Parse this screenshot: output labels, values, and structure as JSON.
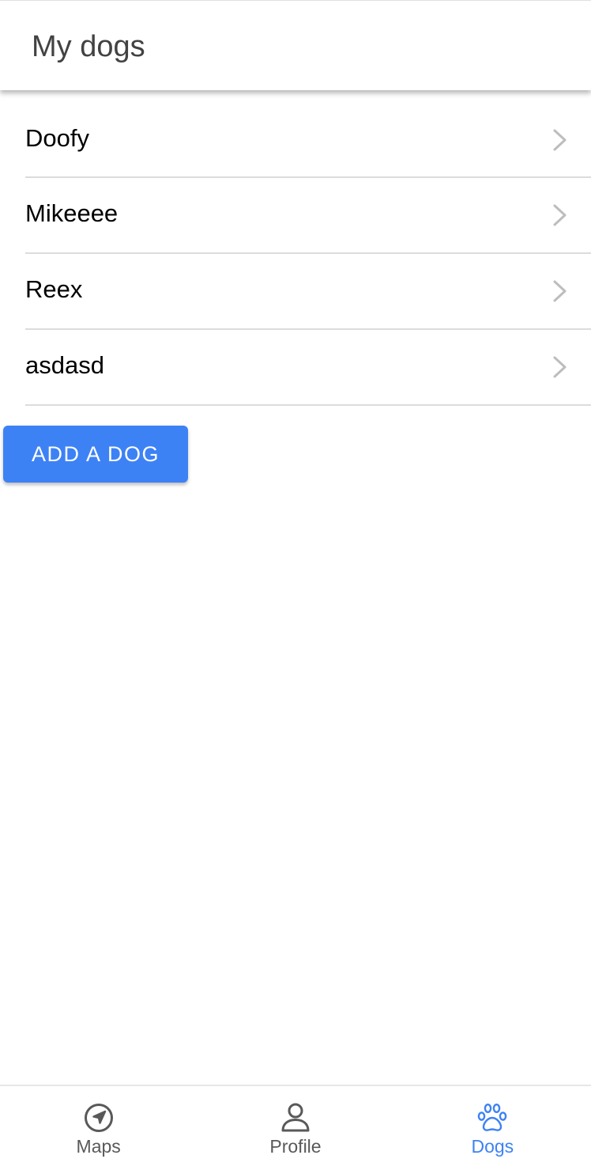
{
  "header": {
    "title": "My dogs"
  },
  "dogs": [
    {
      "name": "Doofy"
    },
    {
      "name": "Mikeeee"
    },
    {
      "name": "Reex"
    },
    {
      "name": "asdasd"
    }
  ],
  "actions": {
    "add_dog_label": "ADD A DOG"
  },
  "tabbar": {
    "tabs": [
      {
        "label": "Maps",
        "icon": "navigation-icon",
        "active": false
      },
      {
        "label": "Profile",
        "icon": "person-icon",
        "active": false
      },
      {
        "label": "Dogs",
        "icon": "paw-icon",
        "active": true
      }
    ]
  },
  "colors": {
    "accent": "#3d82f5",
    "inactive_tab": "#595959",
    "divider": "#dcdcdc",
    "chevron": "#bdbdbd"
  }
}
